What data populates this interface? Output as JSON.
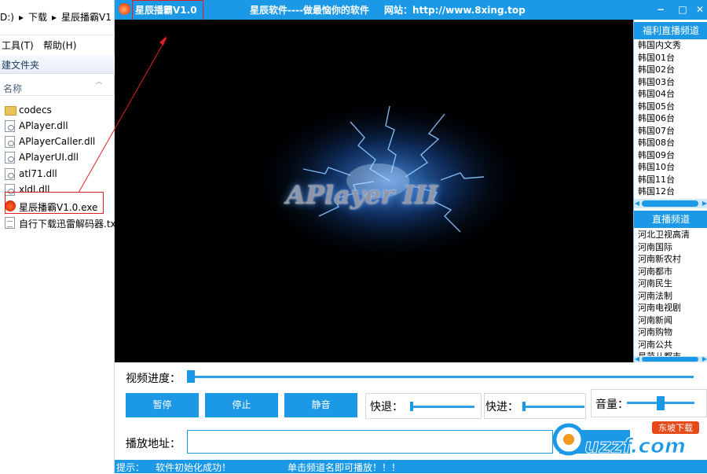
{
  "explorer": {
    "path": [
      "D:)",
      "▸",
      "下载",
      "▸",
      "星辰播霸V1"
    ],
    "menu": [
      "工具(T)",
      "帮助(H)"
    ],
    "toolbar_button": "建文件夹",
    "column_name": "名称",
    "files": [
      {
        "name": "codecs",
        "icon": "folder-icon"
      },
      {
        "name": "APlayer.dll",
        "icon": "dll-file-icon"
      },
      {
        "name": "APlayerCaller.dll",
        "icon": "dll-file-icon"
      },
      {
        "name": "APlayerUI.dll",
        "icon": "dll-file-icon"
      },
      {
        "name": "atl71.dll",
        "icon": "dll-file-icon"
      },
      {
        "name": "xldl.dll",
        "icon": "dll-file-icon"
      },
      {
        "name": "星辰播霸V1.0.exe",
        "icon": "app-exe-icon"
      },
      {
        "name": "自行下载迅雷解码器.txt",
        "icon": "text-file-icon"
      }
    ]
  },
  "app": {
    "title": "星辰播霸V1.0",
    "slogan": "星辰软件----做最恼你的软件",
    "website": "网站：http://www.8xing.top",
    "window_buttons": {
      "minimize": "−",
      "maximize": "□",
      "close": "✕"
    },
    "video_logo": "APlayer III",
    "colors": {
      "accent": "#1b98e6",
      "annotation": "#e02020"
    }
  },
  "channels": {
    "welfare": {
      "title": "福利直播频道",
      "items": [
        "韩国内文秀",
        "韩国01台",
        "韩国02台",
        "韩国03台",
        "韩国04台",
        "韩国05台",
        "韩国06台",
        "韩国07台",
        "韩国08台",
        "韩国09台",
        "韩国10台",
        "韩国11台",
        "韩国12台"
      ]
    },
    "live": {
      "title": "直播频道",
      "items": [
        "河北卫视高清",
        "河南国际",
        "河南新农村",
        "河南都市",
        "河南民生",
        "河南法制",
        "河南电视剧",
        "河南新闻",
        "河南购物",
        "河南公共",
        "星范儿都市"
      ]
    }
  },
  "controls": {
    "progress_label": "视频进度：",
    "progress_value": 0,
    "pause": "暂停",
    "stop": "停止",
    "mute": "静音",
    "rewind_label": "快退：",
    "forward_label": "快进：",
    "volume_label": "音量：",
    "volume_value": 0.5,
    "url_label": "播放地址：",
    "url_value": ""
  },
  "status": {
    "prefix": "提示：",
    "message": "软件初始化成功！",
    "hint": "单击频道名即可播放！！！"
  },
  "watermark": {
    "brand": "uzzf.com",
    "tag": "东坡下载"
  }
}
